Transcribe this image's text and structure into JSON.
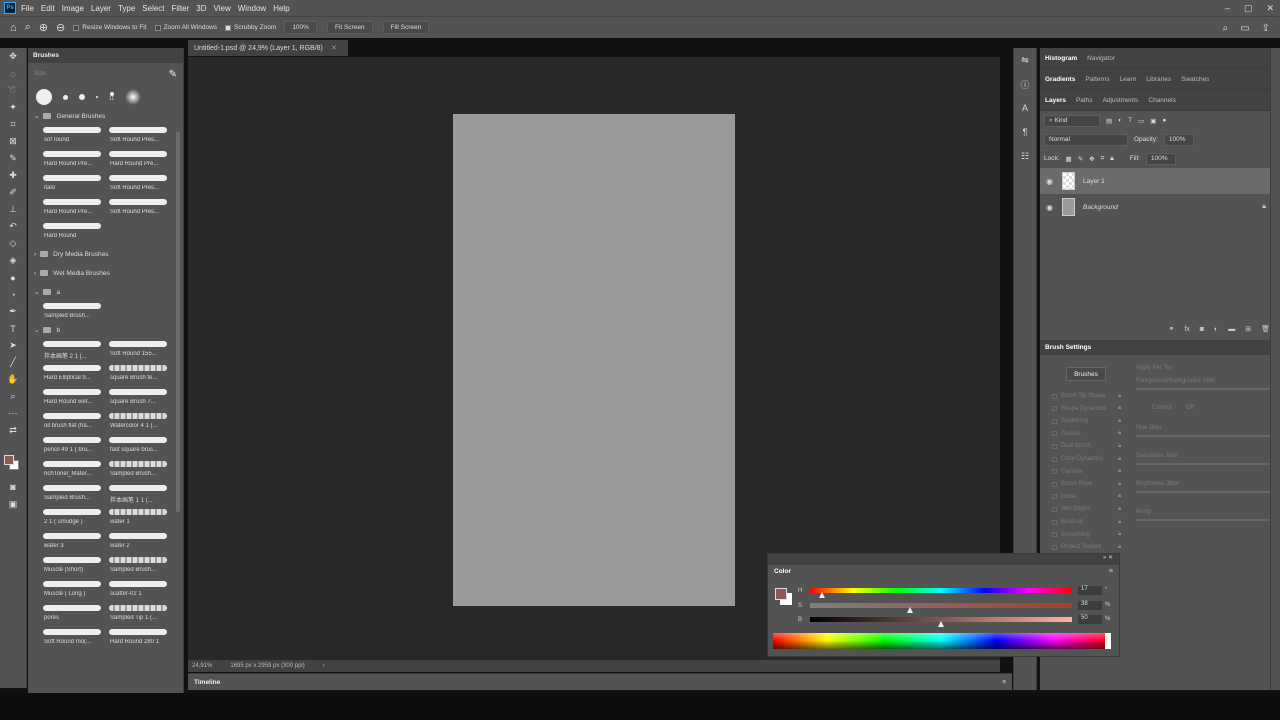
{
  "menu": [
    "File",
    "Edit",
    "Image",
    "Layer",
    "Type",
    "Select",
    "Filter",
    "3D",
    "View",
    "Window",
    "Help"
  ],
  "options": {
    "resize_windows": "Resize Windows to Fit",
    "zoom_all": "Zoom All Windows",
    "scrubby": "Scrubby Zoom",
    "zoom_value": "100%",
    "fit_screen": "Fit Screen",
    "fill_screen": "Fill Screen"
  },
  "brushes_panel": {
    "title": "Brushes",
    "size_label": "Size:",
    "preset_number": "11",
    "general_folder": "General Brushes",
    "general": [
      "sof round",
      "Soft Round Pres...",
      "Hard Round Pre...",
      "Hard Round Pre...",
      "italo",
      "Soft Round Pres...",
      "Hard Round Pre...",
      "Soft Round Pres...",
      "Hard Round"
    ],
    "dry_folder": "Dry Media Brushes",
    "wet_folder": "Wet Media Brushes",
    "a_folder": "a",
    "a_items": [
      "Sampled Brush..."
    ],
    "b_folder": "b",
    "b_items": [
      "拌本画笔 2 1 (...",
      "Soft Round 155...",
      "Hard Elliptical 9...",
      "square Brush te...",
      "Hard Round wet...",
      "square Brush 7...",
      "oil brush flat (ha...",
      "Watercolor 4 1 (...",
      "pencil 49 1 ( bru...",
      "fast square brus...",
      "richTonel_Mater...",
      "Sampled Brush...",
      "Sampled Brush...",
      "拌本画笔 1 1 (...",
      "2 1 ( smudge )",
      "water 1",
      "water 3",
      "water 2",
      "Muscle (Short)",
      "Sampled Brush...",
      "Muscle ( Long )",
      "scatter-02 1",
      "pores",
      "Sampled Tip 1 (...",
      "Soft Round mo(...",
      "Hard Round 280 1"
    ]
  },
  "document": {
    "tab": "Untitled-1.psd @ 24,9% (Layer 1, RGB/8)",
    "zoom": "24,91%",
    "dims": "1695 px x 2959 px (300 ppi)",
    "timeline": "Timeline"
  },
  "right": {
    "tabs1": [
      "Histogram",
      "Navigator"
    ],
    "tabs2": [
      "Gradients",
      "Patterns",
      "Learn",
      "Libraries",
      "Swatches"
    ],
    "tabs3": [
      "Layers",
      "Paths",
      "Adjustments",
      "Channels"
    ],
    "kind": "Kind",
    "blend": "Normal",
    "opacity_label": "Opacity:",
    "opacity": "100%",
    "lock_label": "Lock:",
    "fill_label": "Fill:",
    "fill": "100%",
    "layers": [
      "Layer 1",
      "Background"
    ]
  },
  "brush_settings": {
    "title": "Brush Settings",
    "brushes_btn": "Brushes",
    "apply_per_tip": "Apply Per Tip",
    "fg_bg_jitter": "Foreground/Background Jitter",
    "control": "Control:",
    "control_val": "Off",
    "hue": "Hue Jitter",
    "sat": "Saturation Jitter",
    "bright": "Brightness Jitter",
    "purity": "Purity",
    "options": [
      "Brush Tip Shape",
      "Shape Dynamics",
      "Scattering",
      "Texture",
      "Dual Brush",
      "Color Dynamics",
      "Transfer",
      "Brush Pose",
      "Noise",
      "Wet Edges",
      "Build-up",
      "Smoothing",
      "Protect Texture"
    ]
  },
  "color_panel": {
    "title": "Color",
    "h_label": "H",
    "s_label": "S",
    "b_label": "B",
    "h": "17",
    "s": "38",
    "b": "50",
    "h_unit": "°",
    "s_unit": "%",
    "b_unit": "%",
    "h_fraction": 0.047,
    "s_fraction": 0.38,
    "b_fraction": 0.5,
    "fg_color": "#8c5a52"
  }
}
